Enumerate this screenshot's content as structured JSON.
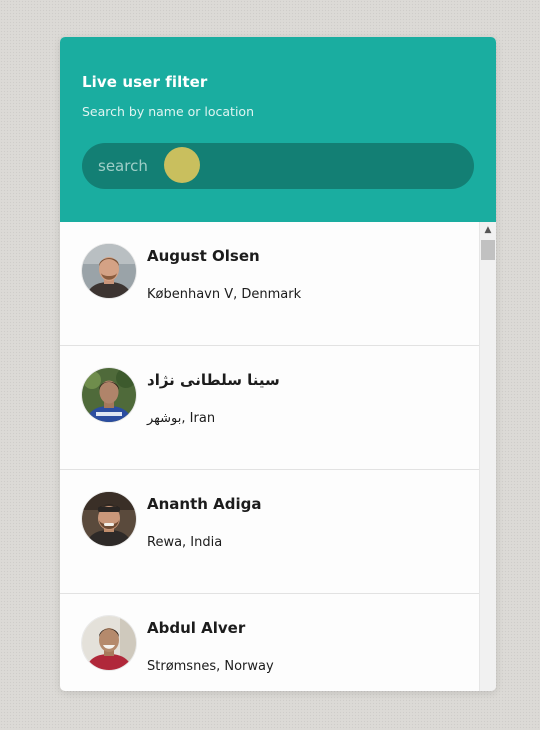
{
  "header": {
    "title": "Live user filter",
    "subtitle": "Search by name or location",
    "search_placeholder": "search"
  },
  "users": [
    {
      "name": "August Olsen",
      "location": "København V, Denmark"
    },
    {
      "name": "سینا سلطانی نژاد",
      "location": "بوشهر, Iran"
    },
    {
      "name": "Ananth Adiga",
      "location": "Rewa, India"
    },
    {
      "name": "Abdul Alver",
      "location": "Strømsnes, Norway"
    }
  ],
  "scrollbar": {
    "up_arrow_icon": "chevron-up-icon"
  },
  "colors": {
    "header_bg": "#1aada0",
    "search_bg": "#137f74",
    "cursor_highlight": "#c9bf5e",
    "card_bg": "#fdfdfd"
  }
}
